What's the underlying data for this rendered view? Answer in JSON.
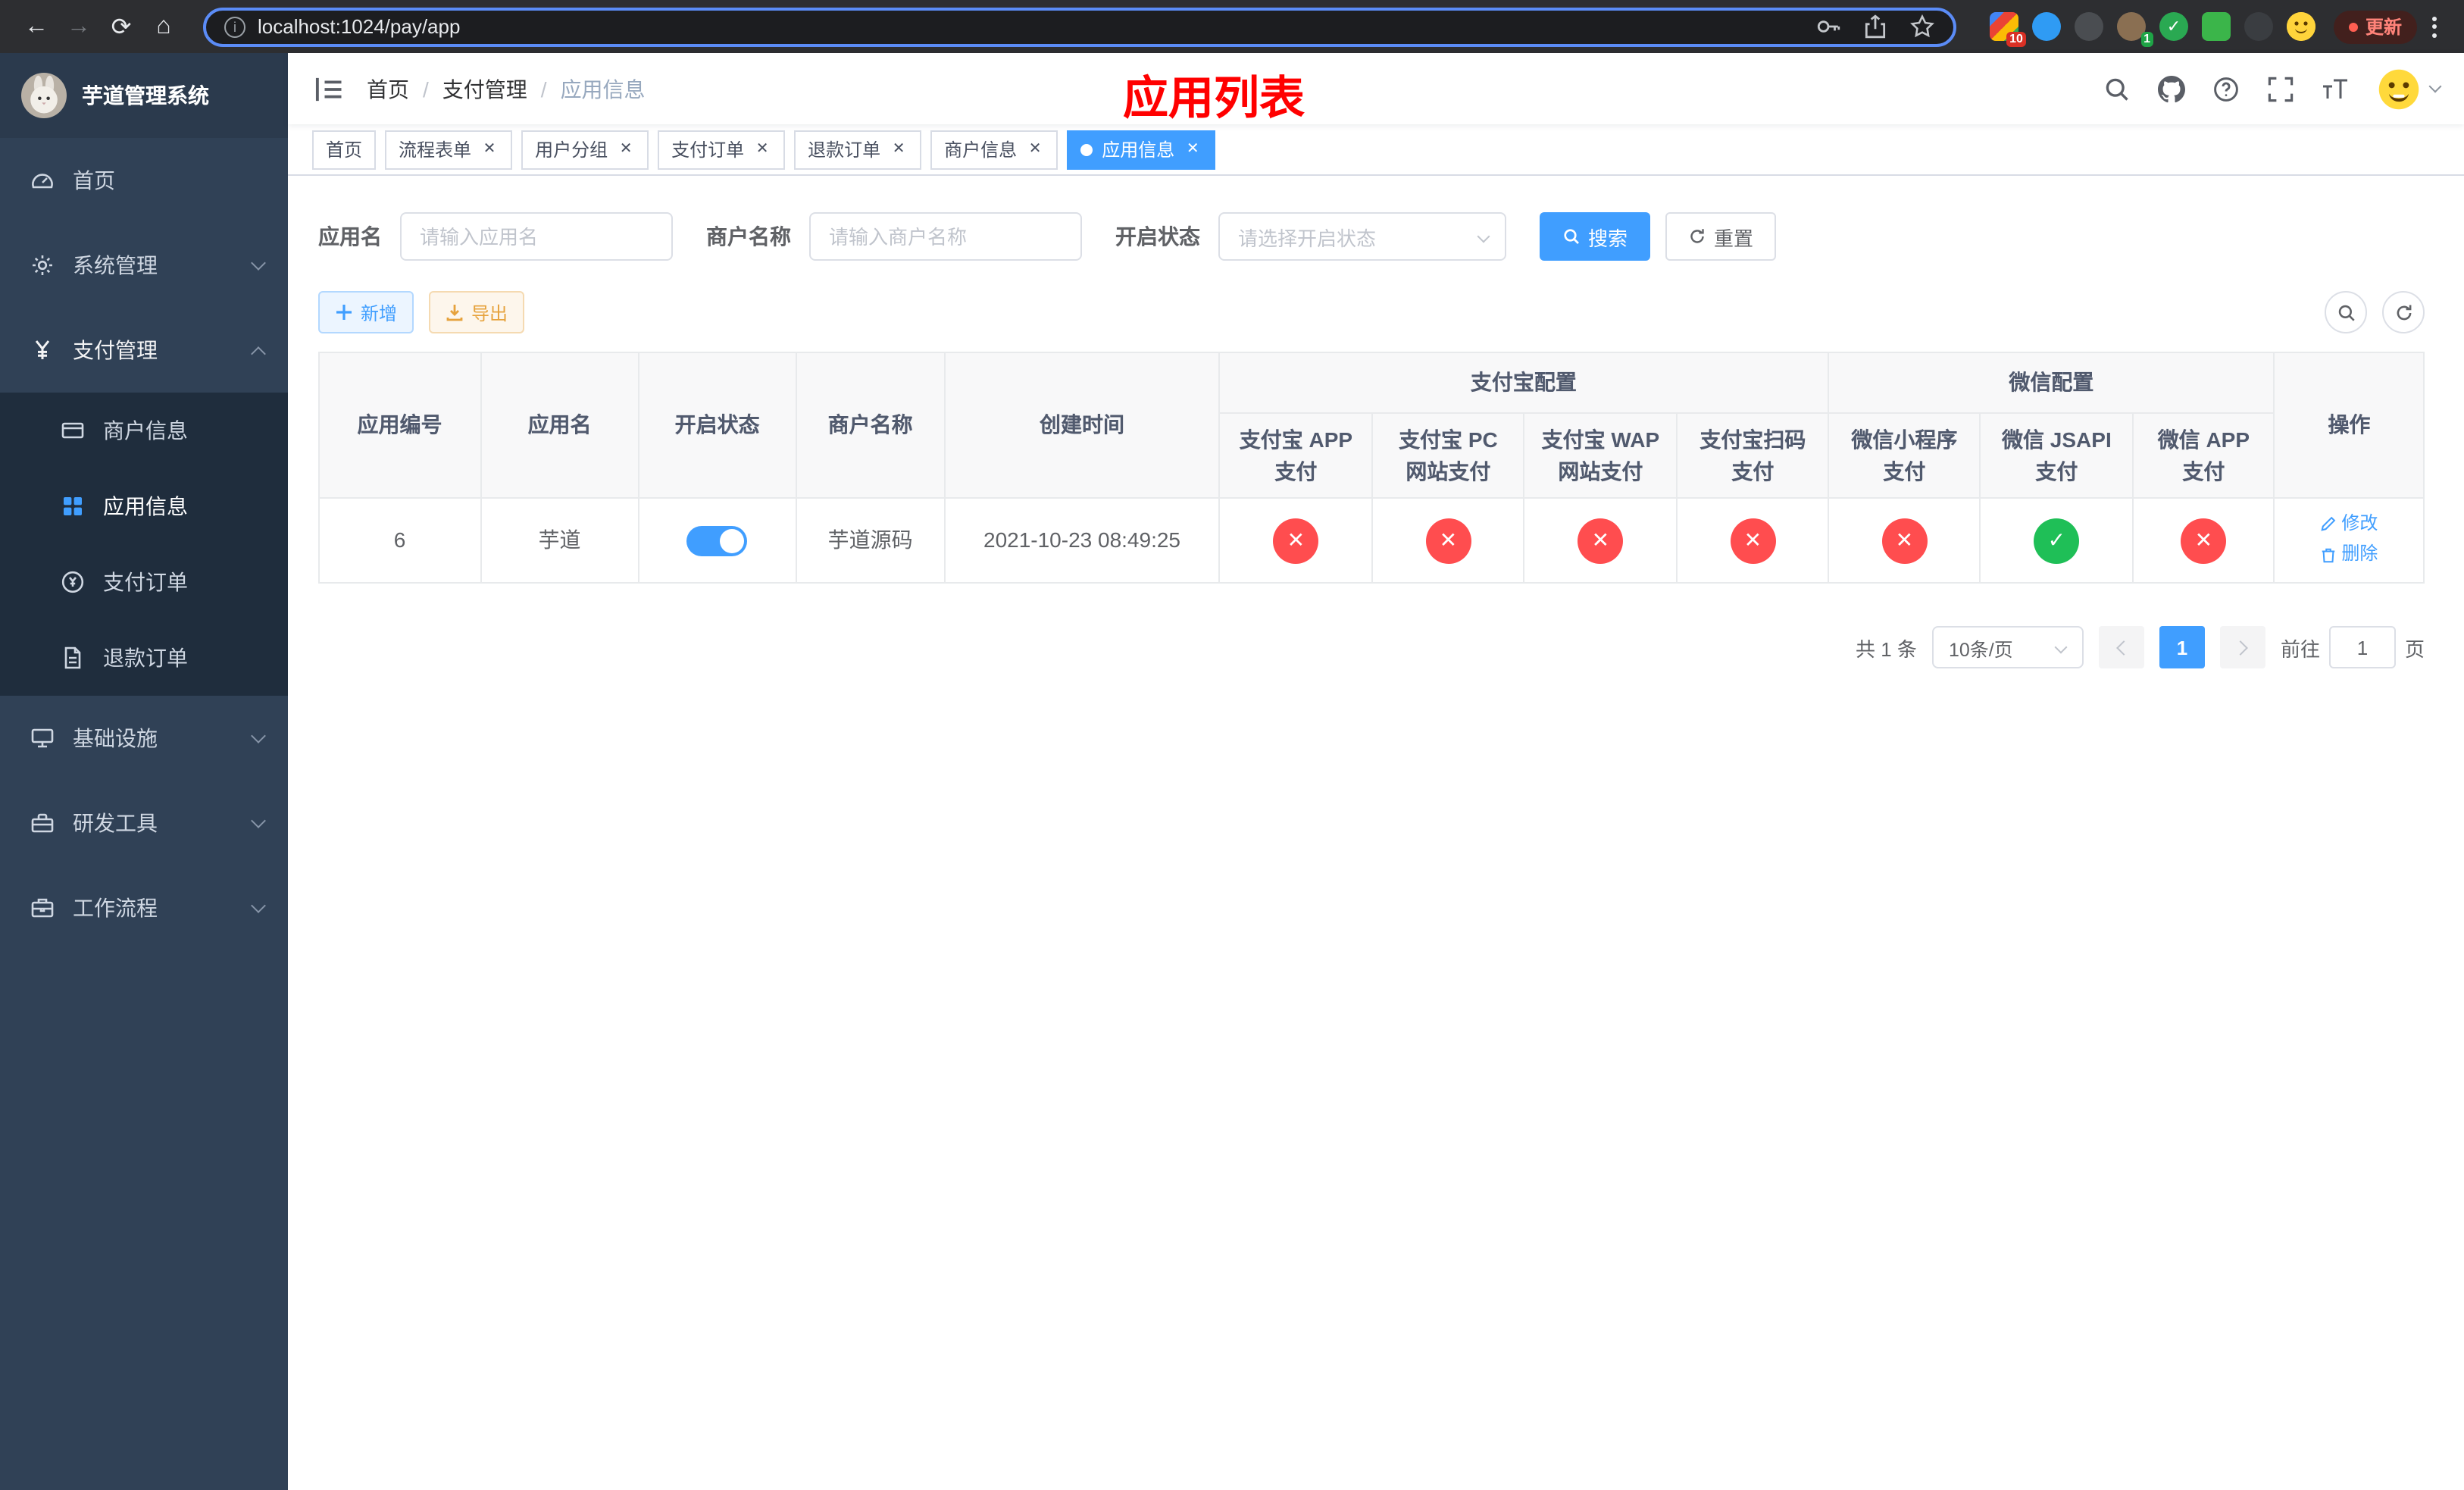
{
  "browser": {
    "url": "localhost:1024/pay/app",
    "update_label": "更新",
    "extension_badge_count": "10",
    "avatar_badge_count": "1"
  },
  "sidebar": {
    "logo_title": "芋道管理系统",
    "menu": [
      {
        "label": "首页"
      },
      {
        "label": "系统管理"
      },
      {
        "label": "支付管理"
      },
      {
        "label": "商户信息"
      },
      {
        "label": "应用信息"
      },
      {
        "label": "支付订单"
      },
      {
        "label": "退款订单"
      },
      {
        "label": "基础设施"
      },
      {
        "label": "研发工具"
      },
      {
        "label": "工作流程"
      }
    ]
  },
  "navbar": {
    "breadcrumb": [
      "首页",
      "支付管理",
      "应用信息"
    ]
  },
  "annotation": {
    "title": "应用列表"
  },
  "tabs": [
    {
      "label": "首页"
    },
    {
      "label": "流程表单"
    },
    {
      "label": "用户分组"
    },
    {
      "label": "支付订单"
    },
    {
      "label": "退款订单"
    },
    {
      "label": "商户信息"
    },
    {
      "label": "应用信息"
    }
  ],
  "filter": {
    "app_name_label": "应用名",
    "app_name_placeholder": "请输入应用名",
    "merchant_label": "商户名称",
    "merchant_placeholder": "请输入商户名称",
    "status_label": "开启状态",
    "status_placeholder": "请选择开启状态",
    "search_label": "搜索",
    "reset_label": "重置"
  },
  "toolbar": {
    "add_label": "新增",
    "export_label": "导出"
  },
  "table": {
    "headers": {
      "app_id": "应用编号",
      "app_name": "应用名",
      "status": "开启状态",
      "merchant": "商户名称",
      "create_time": "创建时间",
      "alipay_group": "支付宝配置",
      "wechat_group": "微信配置",
      "actions": "操作",
      "alipay_app": "支付宝 APP 支付",
      "alipay_pc": "支付宝 PC 网站支付",
      "alipay_wap": "支付宝 WAP 网站支付",
      "alipay_qr": "支付宝扫码支付",
      "wx_lite": "微信小程序支付",
      "wx_jsapi": "微信 JSAPI 支付",
      "wx_app": "微信 APP 支付"
    },
    "row": {
      "app_id": "6",
      "app_name": "芋道",
      "enabled": "true",
      "merchant": "芋道源码",
      "create_time": "2021-10-23 08:49:25",
      "channels": [
        "disabled",
        "disabled",
        "disabled",
        "disabled",
        "disabled",
        "enabled",
        "disabled"
      ],
      "edit_label": "修改",
      "delete_label": "删除"
    }
  },
  "pagination": {
    "total_text": "共 1 条",
    "page_size": "10条/页",
    "current_page": "1",
    "goto_label": "前往",
    "goto_value": "1",
    "page_unit": "页"
  },
  "colors": {
    "accent": "#409eff",
    "danger": "#ff4d4f",
    "success": "#1fbf57",
    "warning": "#e6a23c",
    "sidebar_bg": "#304156",
    "submenu_bg": "#1f2d3d",
    "annotation": "#ff0000"
  }
}
